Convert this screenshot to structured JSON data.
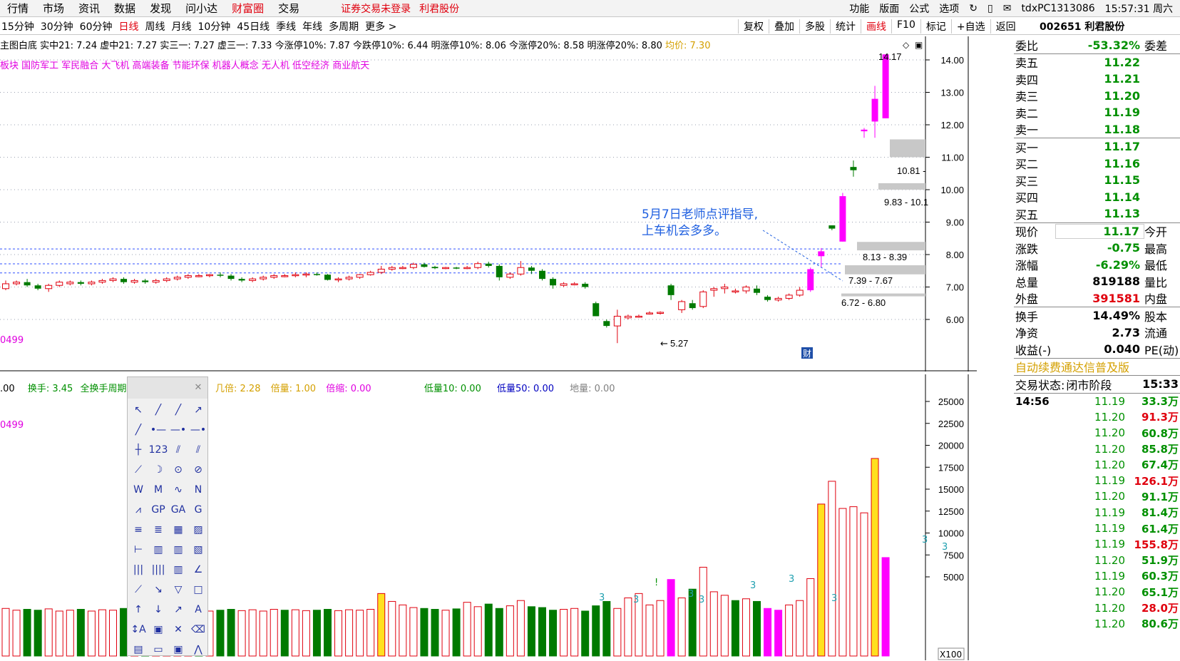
{
  "top_menu": [
    "行情",
    "市场",
    "资讯",
    "数据",
    "发现",
    "问小达",
    "财富圈",
    "交易"
  ],
  "top_menu_active": "财富圈",
  "notice": {
    "trade": "证券交易未登录",
    "stock_name": "利君股份"
  },
  "top_right": {
    "items": [
      "功能",
      "版面",
      "公式",
      "选项"
    ],
    "host": "tdxPC1313086",
    "time": "15:57:31 周六"
  },
  "periods": [
    "15分钟",
    "30分钟",
    "60分钟",
    "日线",
    "周线",
    "月线",
    "10分钟",
    "45日线",
    "季线",
    "年线",
    "多周期",
    "更多 >"
  ],
  "period_active": "日线",
  "chart_tools": [
    "复权",
    "叠加",
    "多股",
    "统计",
    "画线",
    "F10",
    "标记",
    "+自选",
    "返回"
  ],
  "chart_tool_active": "画线",
  "stock_code": "002651 利君股份",
  "info_line": "主图白底  实中21: 7.24  虚中21: 7.27  实三一: 7.27  虚三一: 7.33  今涨停10%: 7.87  今跌停10%: 6.44  明涨停10%: 8.06  今涨停20%: 8.58  明涨停20%: 8.80",
  "avg_price": "均价: 7.30",
  "concepts": "板块  国防军工 军民融合 大飞机 高端装备 节能环保 机器人概念 无人机 低空经济 商业航天",
  "annotation_line1": "5月7日老师点评指导,",
  "annotation_line2": "上车机会多多。",
  "range_labels": [
    "14.17",
    "10.81 -",
    "9.83 - 10.1",
    "8.13 - 8.39",
    "7.39 - 7.67",
    "6.72 - 6.80",
    "5.27"
  ],
  "price_axis": [
    "14.00",
    "13.00",
    "12.00",
    "11.00",
    "10.00",
    "9.00",
    "8.00",
    "7.00",
    "6.00"
  ],
  "vol_axis": [
    "25000",
    "22500",
    "20000",
    "17500",
    "15000",
    "12500",
    "10000",
    "7500",
    "5000"
  ],
  "vol_info": {
    "a": ".00",
    "turnover": "换手: 3.45",
    "period": "全换手周期",
    "c": "5",
    "jl": "几倍: 2.28",
    "bl": "倍量: 1.00",
    "bs": "倍缩: 0.00",
    "dl10": "低量10: 0.00",
    "dl50": "低量50: 0.00",
    "dil": "地量: 0.00"
  },
  "left_code": "0499",
  "x100": "X100",
  "cai_marker": "财",
  "sidebar": {
    "weibi": {
      "label": "委比",
      "value": "-53.32%",
      "label2": "委差"
    },
    "asks": [
      {
        "l": "卖五",
        "p": "11.22"
      },
      {
        "l": "卖四",
        "p": "11.21"
      },
      {
        "l": "卖三",
        "p": "11.20"
      },
      {
        "l": "卖二",
        "p": "11.19"
      },
      {
        "l": "卖一",
        "p": "11.18"
      }
    ],
    "bids": [
      {
        "l": "买一",
        "p": "11.17"
      },
      {
        "l": "买二",
        "p": "11.16"
      },
      {
        "l": "买三",
        "p": "11.15"
      },
      {
        "l": "买四",
        "p": "11.14"
      },
      {
        "l": "买五",
        "p": "11.13"
      }
    ],
    "quote": [
      {
        "l": "现价",
        "v": "11.17",
        "l2": "今开"
      },
      {
        "l": "涨跌",
        "v": "-0.75",
        "l2": "最高"
      },
      {
        "l": "涨幅",
        "v": "-6.29%",
        "l2": "最低"
      },
      {
        "l": "总量",
        "v": "819188",
        "l2": "量比"
      },
      {
        "l": "外盘",
        "v": "391581",
        "l2": "内盘"
      }
    ],
    "stats": [
      {
        "l": "换手",
        "v": "14.49%",
        "l2": "股本"
      },
      {
        "l": "净资",
        "v": "2.73",
        "l2": "流通"
      },
      {
        "l": "收益(-)",
        "v": "0.040",
        "l2": "PE(动)"
      }
    ],
    "banner": "自动续费通达信普及版",
    "status": {
      "label": "交易状态:",
      "value": "闭市阶段",
      "time": "15:33"
    },
    "ticks": [
      {
        "t": "14:56",
        "p": "11.19",
        "v": "33.3万"
      },
      {
        "t": "",
        "p": "11.20",
        "v": "91.3万"
      },
      {
        "t": "",
        "p": "11.20",
        "v": "60.8万"
      },
      {
        "t": "",
        "p": "11.20",
        "v": "85.8万"
      },
      {
        "t": "",
        "p": "11.20",
        "v": "67.4万"
      },
      {
        "t": "",
        "p": "11.19",
        "v": "126.1万"
      },
      {
        "t": "",
        "p": "11.20",
        "v": "91.1万"
      },
      {
        "t": "",
        "p": "11.19",
        "v": "81.4万"
      },
      {
        "t": "",
        "p": "11.19",
        "v": "61.4万"
      },
      {
        "t": "",
        "p": "11.19",
        "v": "155.8万"
      },
      {
        "t": "",
        "p": "11.20",
        "v": "51.9万"
      },
      {
        "t": "",
        "p": "11.19",
        "v": "60.3万"
      },
      {
        "t": "",
        "p": "11.20",
        "v": "65.1万"
      },
      {
        "t": "",
        "p": "11.20",
        "v": "28.0万"
      },
      {
        "t": "",
        "p": "11.20",
        "v": "80.6万"
      }
    ]
  },
  "chart_data": {
    "type": "candlestick",
    "price_range": [
      5.0,
      14.5
    ],
    "candles": [
      [
        6.95,
        7.2,
        6.9,
        7.1
      ],
      [
        7.1,
        7.2,
        7.05,
        7.15
      ],
      [
        7.15,
        7.25,
        7.0,
        7.05
      ],
      [
        7.05,
        7.1,
        6.9,
        6.95
      ],
      [
        6.95,
        7.1,
        6.85,
        7.05
      ],
      [
        7.05,
        7.2,
        7.0,
        7.15
      ],
      [
        7.1,
        7.2,
        7.05,
        7.15
      ],
      [
        7.15,
        7.2,
        7.05,
        7.1
      ],
      [
        7.1,
        7.2,
        7.05,
        7.15
      ],
      [
        7.15,
        7.25,
        7.1,
        7.2
      ],
      [
        7.2,
        7.3,
        7.15,
        7.25
      ],
      [
        7.25,
        7.3,
        7.1,
        7.15
      ],
      [
        7.15,
        7.25,
        7.1,
        7.2
      ],
      [
        7.2,
        7.25,
        7.1,
        7.15
      ],
      [
        7.15,
        7.25,
        7.1,
        7.2
      ],
      [
        7.2,
        7.3,
        7.15,
        7.25
      ],
      [
        7.25,
        7.35,
        7.2,
        7.3
      ],
      [
        7.3,
        7.4,
        7.25,
        7.35
      ],
      [
        7.35,
        7.4,
        7.3,
        7.35
      ],
      [
        7.35,
        7.4,
        7.3,
        7.38
      ],
      [
        7.38,
        7.45,
        7.3,
        7.35
      ],
      [
        7.35,
        7.4,
        7.2,
        7.25
      ],
      [
        7.25,
        7.3,
        7.15,
        7.2
      ],
      [
        7.2,
        7.3,
        7.15,
        7.25
      ],
      [
        7.25,
        7.35,
        7.2,
        7.3
      ],
      [
        7.3,
        7.4,
        7.25,
        7.35
      ],
      [
        7.35,
        7.4,
        7.3,
        7.35
      ],
      [
        7.35,
        7.45,
        7.3,
        7.38
      ],
      [
        7.38,
        7.45,
        7.3,
        7.4
      ],
      [
        7.4,
        7.45,
        7.35,
        7.38
      ],
      [
        7.38,
        7.4,
        7.2,
        7.22
      ],
      [
        7.22,
        7.3,
        7.15,
        7.25
      ],
      [
        7.25,
        7.35,
        7.2,
        7.3
      ],
      [
        7.3,
        7.4,
        7.25,
        7.38
      ],
      [
        7.38,
        7.5,
        7.35,
        7.45
      ],
      [
        7.45,
        7.65,
        7.4,
        7.55
      ],
      [
        7.55,
        7.65,
        7.5,
        7.6
      ],
      [
        7.6,
        7.65,
        7.55,
        7.6
      ],
      [
        7.6,
        7.75,
        7.55,
        7.7
      ],
      [
        7.7,
        7.75,
        7.6,
        7.62
      ],
      [
        7.62,
        7.65,
        7.55,
        7.58
      ],
      [
        7.58,
        7.62,
        7.55,
        7.6
      ],
      [
        7.6,
        7.62,
        7.55,
        7.58
      ],
      [
        7.58,
        7.65,
        7.55,
        7.6
      ],
      [
        7.6,
        7.78,
        7.55,
        7.72
      ],
      [
        7.72,
        7.78,
        7.6,
        7.65
      ],
      [
        7.65,
        7.7,
        7.2,
        7.3
      ],
      [
        7.3,
        7.45,
        7.25,
        7.4
      ],
      [
        7.4,
        7.8,
        7.35,
        7.6
      ],
      [
        7.6,
        7.65,
        7.4,
        7.5
      ],
      [
        7.5,
        7.55,
        7.2,
        7.25
      ],
      [
        7.25,
        7.3,
        6.95,
        7.05
      ],
      [
        7.05,
        7.15,
        7.0,
        7.1
      ],
      [
        7.1,
        7.15,
        7.05,
        7.1
      ],
      [
        7.1,
        7.15,
        6.95,
        7.0
      ],
      [
        6.5,
        6.55,
        6.1,
        6.1
      ],
      [
        5.95,
        6.0,
        5.75,
        5.8
      ],
      [
        5.8,
        6.3,
        5.27,
        6.1
      ],
      [
        6.05,
        6.15,
        6.0,
        6.1
      ],
      [
        6.1,
        6.15,
        6.05,
        6.1
      ],
      [
        6.2,
        6.25,
        6.15,
        6.2
      ],
      [
        6.2,
        6.25,
        6.15,
        6.22
      ],
      [
        7.05,
        7.1,
        6.6,
        6.75
      ],
      [
        6.3,
        6.6,
        6.2,
        6.55
      ],
      [
        6.5,
        6.6,
        6.3,
        6.35
      ],
      [
        6.4,
        6.9,
        6.35,
        6.85
      ],
      [
        6.9,
        7.0,
        6.7,
        6.95
      ],
      [
        6.95,
        7.1,
        6.8,
        7.0
      ],
      [
        6.85,
        6.95,
        6.8,
        6.88
      ],
      [
        6.88,
        7.05,
        6.8,
        7.0
      ],
      [
        6.95,
        7.05,
        6.75,
        6.82
      ],
      [
        6.7,
        6.75,
        6.55,
        6.6
      ],
      [
        6.6,
        6.7,
        6.55,
        6.65
      ],
      [
        6.65,
        6.8,
        6.6,
        6.75
      ],
      [
        6.75,
        7.0,
        6.7,
        6.9
      ],
      [
        6.9,
        7.6,
        6.85,
        7.55
      ],
      [
        7.95,
        8.2,
        7.6,
        8.1
      ],
      [
        8.9,
        8.9,
        8.75,
        8.8
      ],
      [
        8.4,
        9.9,
        8.4,
        9.8
      ],
      [
        10.7,
        10.9,
        10.4,
        10.6
      ],
      [
        11.8,
        11.9,
        11.6,
        11.85
      ],
      [
        12.1,
        13.2,
        11.6,
        12.8
      ],
      [
        12.2,
        14.17,
        12.2,
        14.17
      ]
    ],
    "volumes": [
      1400,
      1200,
      1300,
      1200,
      1350,
      1100,
      1200,
      1300,
      1100,
      1250,
      1200,
      1400,
      1200,
      1300,
      1250,
      1150,
      1200,
      1300,
      1250,
      1100,
      1200,
      1300,
      1150,
      1250,
      1100,
      1300,
      1200,
      1250,
      1150,
      1200,
      1300,
      1150,
      1250,
      1200,
      1300,
      3100,
      2200,
      1800,
      1500,
      1400,
      1300,
      1200,
      1350,
      2100,
      1600,
      1900,
      1400,
      1700,
      2300,
      1600,
      1500,
      1200,
      1300,
      1400,
      1100,
      1700,
      2200,
      1400,
      2600,
      3100,
      1800,
      2300,
      4700,
      2600,
      3600,
      6100,
      3300,
      2900,
      2300,
      2500,
      2200,
      1400,
      1200,
      1800,
      2300,
      4800,
      13300,
      15900,
      12800,
      13000,
      12300,
      18500,
      7200
    ],
    "volume_up_flags": [
      1,
      1,
      0,
      0,
      1,
      1,
      1,
      0,
      1,
      1,
      1,
      0,
      1,
      0,
      1,
      1,
      1,
      1,
      0,
      1,
      0,
      0,
      1,
      1,
      1,
      1,
      0,
      1,
      1,
      0,
      0,
      1,
      1,
      1,
      1,
      1,
      1,
      1,
      1,
      0,
      0,
      1,
      0,
      1,
      1,
      0,
      0,
      1,
      1,
      0,
      0,
      0,
      1,
      1,
      0,
      0,
      0,
      1,
      1,
      1,
      1,
      1,
      0,
      1,
      0,
      1,
      1,
      1,
      0,
      1,
      0,
      0,
      1,
      1,
      1,
      1,
      1,
      1,
      1,
      1,
      1,
      1,
      0
    ]
  },
  "toolbox_icons": [
    "pointer-icon",
    "line-icon",
    "ray-icon",
    "arrow-line-icon",
    "diagonal-icon",
    "h-segment-icon",
    "h-line-icon",
    "h-ray-icon",
    "v-line-icon",
    "price-label-icon",
    "parallel-icon",
    "channel-icon",
    "fib-line-icon",
    "arc-icon",
    "circle-icon",
    "cycle-icon",
    "wave-w-icon",
    "wave-m-icon",
    "trend-icon",
    "zigzag-icon",
    "polyline-icon",
    "gp-icon",
    "ga-icon",
    "g-icon",
    "fib-fan-icon",
    "fib-retrace-icon",
    "grid-icon",
    "ladder-icon",
    "period-icon",
    "bars-icon",
    "time-zone-icon",
    "gann-icon",
    "multi-bars-icon",
    "dense-bars-icon",
    "bar-grid-icon",
    "angle-icon",
    "fan-icon",
    "down-arrow-icon",
    "triangle-icon",
    "rectangle-icon",
    "up-mark-icon",
    "down-mark-icon",
    "buy-sell-icon",
    "text-icon",
    "label-icon",
    "block-icon",
    "delete-icon",
    "erase-icon",
    "list-icon",
    "ruler-icon",
    "screenshot-icon",
    "measure-icon"
  ],
  "toolbox_glyphs": [
    "↖",
    "╱",
    "╱",
    "↗",
    "╱",
    "•—",
    "—•",
    "—•",
    "┼",
    "123",
    "⫽",
    "⫽",
    "⟋",
    "☽",
    "⊙",
    "⊘",
    "W",
    "M",
    "∿",
    "N",
    "⩘",
    "GP",
    "GA",
    "G",
    "≡",
    "≣",
    "▦",
    "▨",
    "⊢",
    "▥",
    "▥",
    "▧",
    "|||",
    "||||",
    "▥",
    "∠",
    "⟋",
    "↘",
    "▽",
    "□",
    "↑",
    "↓",
    "↗",
    "A",
    "↕A",
    "▣",
    "✕",
    "⌫",
    "▤",
    "▭",
    "▣",
    "⋀"
  ]
}
